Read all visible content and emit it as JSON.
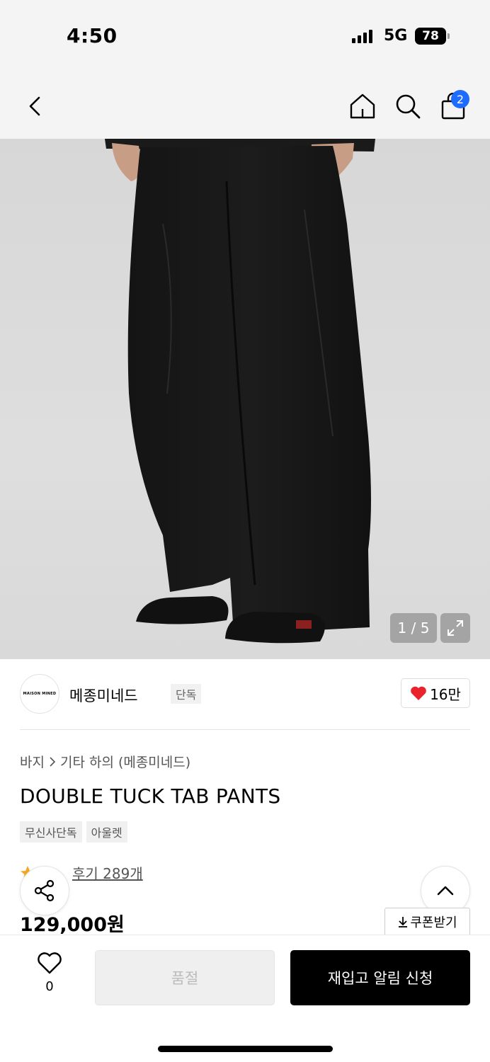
{
  "status": {
    "time": "4:50",
    "network": "5G",
    "battery": "78"
  },
  "nav": {
    "back_icon": "chevron-left-icon",
    "home_icon": "home-icon",
    "search_icon": "search-icon",
    "cart_icon": "shopping-bag-icon",
    "cart_badge": "2"
  },
  "image": {
    "counter": "1 / 5",
    "expand_icon": "expand-icon"
  },
  "brand": {
    "logo_text": "MAISON MINED",
    "name": "메종미네드",
    "tag": "단독",
    "likes": "16만"
  },
  "product": {
    "breadcrumb": [
      "바지",
      "기타 하의",
      "(메종미네드)"
    ],
    "title": "DOUBLE TUCK TAB PANTS",
    "tags": [
      "무신사단독",
      "아울렛"
    ],
    "review_link": "후기 289개",
    "price": "129,000원",
    "coupon_label": "쿠폰받기"
  },
  "bottom": {
    "wish_count": "0",
    "soldout_label": "품절",
    "restock_label": "재입고 알림 신청"
  },
  "colors": {
    "accent_blue": "#1e6bff",
    "heart_red": "#e8232b",
    "star_orange": "#f5a623"
  }
}
